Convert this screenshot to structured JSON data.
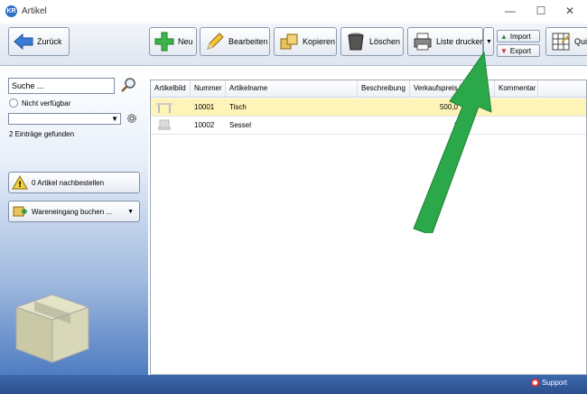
{
  "window": {
    "title": "Artikel",
    "app_icon": "kr-logo-icon"
  },
  "toolbar": {
    "back": "Zurück",
    "new": "Neu",
    "edit": "Bearbeiten",
    "copy": "Kopieren",
    "delete": "Löschen",
    "print_list": "Liste drucken",
    "import": "Import",
    "export": "Export",
    "quick": "Qui"
  },
  "sidebar": {
    "search_value": "Suche ...",
    "not_available": "Nicht verfügbar",
    "filter_value": "",
    "found": "2 Einträge gefunden",
    "reorder": "0 Artikel nachbestellen",
    "goods_receipt": "Wareneingang buchen ..."
  },
  "grid": {
    "columns": [
      "Artikelbild",
      "Nummer",
      "Artikelname",
      "Beschreibung",
      "Verkaufspreis",
      "be",
      "Kommentar"
    ],
    "rows": [
      {
        "nummer": "10001",
        "name": "Tisch",
        "beschreibung": "",
        "preis": "500,0",
        "extra": "",
        "kommentar": ""
      },
      {
        "nummer": "10002",
        "name": "Sessel",
        "beschreibung": "",
        "preis": "1",
        "extra": "",
        "kommentar": ""
      }
    ]
  },
  "statusbar": {
    "support": "Support"
  },
  "colors": {
    "accent_blue": "#2f5ea8",
    "selection": "#fff4b8",
    "arrow_green": "#2ba84a"
  }
}
